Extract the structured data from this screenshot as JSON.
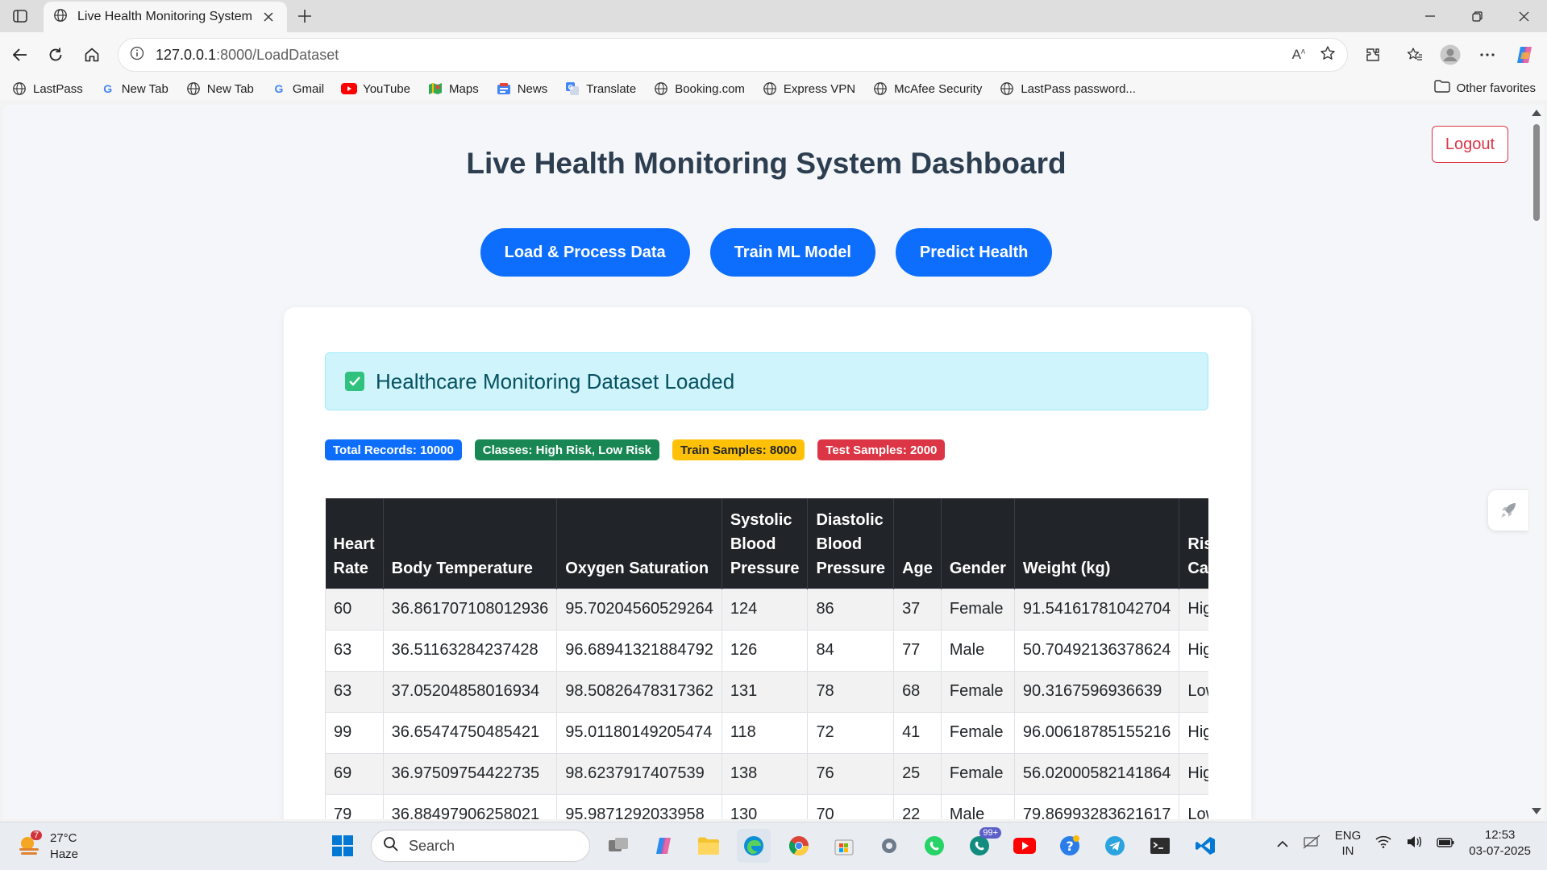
{
  "browser": {
    "tab_title": "Live Health Monitoring System",
    "url_host": "127.0.0.1",
    "url_path": ":8000/LoadDataset",
    "bookmarks": [
      "LastPass",
      "New Tab",
      "New Tab",
      "Gmail",
      "YouTube",
      "Maps",
      "News",
      "Translate",
      "Booking.com",
      "Express VPN",
      "McAfee Security",
      "LastPass password..."
    ],
    "other_favorites": "Other favorites"
  },
  "page": {
    "logout_label": "Logout",
    "title": "Live Health Monitoring System Dashboard",
    "actions": [
      "Load & Process Data",
      "Train ML Model",
      "Predict Health"
    ],
    "alert_text": "Healthcare Monitoring Dataset Loaded",
    "badges": {
      "total": "Total Records: 10000",
      "classes": "Classes: High Risk, Low Risk",
      "train": "Train Samples: 8000",
      "test": "Test Samples: 2000"
    },
    "table": {
      "headers": [
        "Heart Rate",
        "Body Temperature",
        "Oxygen Saturation",
        "Systolic Blood Pressure",
        "Diastolic Blood Pressure",
        "Age",
        "Gender",
        "Weight (kg)",
        "Risk Category"
      ],
      "rows": [
        [
          "60",
          "36.861707108012936",
          "95.70204560529264",
          "124",
          "86",
          "37",
          "Female",
          "91.54161781042704",
          "High Risk"
        ],
        [
          "63",
          "36.51163284237428",
          "96.68941321884792",
          "126",
          "84",
          "77",
          "Male",
          "50.70492136378624",
          "High Risk"
        ],
        [
          "63",
          "37.05204858016934",
          "98.50826478317362",
          "131",
          "78",
          "68",
          "Female",
          "90.3167596936639",
          "Low Risk"
        ],
        [
          "99",
          "36.65474750485421",
          "95.01180149205474",
          "118",
          "72",
          "41",
          "Female",
          "96.00618785155216",
          "High Risk"
        ],
        [
          "69",
          "36.97509754422735",
          "98.6237917407539",
          "138",
          "76",
          "25",
          "Female",
          "56.02000582141864",
          "High Risk"
        ],
        [
          "79",
          "36.88497906258021",
          "95.9871292033958",
          "130",
          "70",
          "22",
          "Male",
          "79.86993283621617",
          "Low Risk"
        ]
      ]
    }
  },
  "taskbar": {
    "weather_temp": "27°C",
    "weather_desc": "Haze",
    "weather_badge": "7",
    "search_placeholder": "Search",
    "whatsapp_badge": "99+",
    "lang_line1": "ENG",
    "lang_line2": "IN",
    "time": "12:53",
    "date": "03-07-2025"
  },
  "colors": {
    "primary": "#0d6efd",
    "danger": "#dc3545",
    "success": "#198754",
    "warning": "#ffc107",
    "title": "#2c3e50",
    "table_header": "#212529"
  }
}
